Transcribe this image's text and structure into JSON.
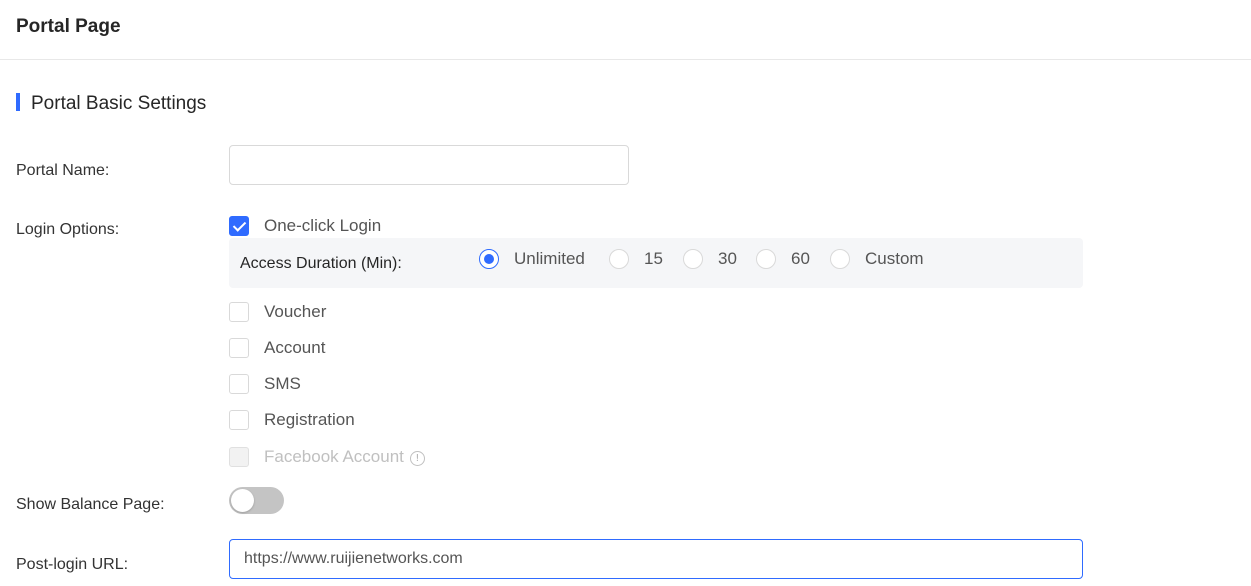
{
  "header": {
    "title": "Portal Page"
  },
  "section": {
    "title": "Portal Basic Settings"
  },
  "form": {
    "portal_name": {
      "label": "Portal Name:",
      "value": "",
      "placeholder": ""
    },
    "login_options": {
      "label": "Login Options:",
      "one_click": {
        "label": "One-click Login",
        "checked": true
      },
      "access_duration": {
        "label": "Access Duration (Min):",
        "options": [
          "Unlimited",
          "15",
          "30",
          "60",
          "Custom"
        ],
        "selected": "Unlimited"
      },
      "voucher": {
        "label": "Voucher",
        "checked": false
      },
      "account": {
        "label": "Account",
        "checked": false
      },
      "sms": {
        "label": "SMS",
        "checked": false
      },
      "registration": {
        "label": "Registration",
        "checked": false
      },
      "facebook": {
        "label": "Facebook Account",
        "checked": false,
        "disabled": true,
        "icon": "info-icon"
      }
    },
    "show_balance": {
      "label": "Show Balance Page:",
      "enabled": false
    },
    "post_login_url": {
      "label": "Post-login URL:",
      "value": "https://www.ruijienetworks.com"
    }
  },
  "colors": {
    "accent": "#2f6bff",
    "toggle_off": "#c4c4c4",
    "duration_bg": "#f5f6f8"
  }
}
